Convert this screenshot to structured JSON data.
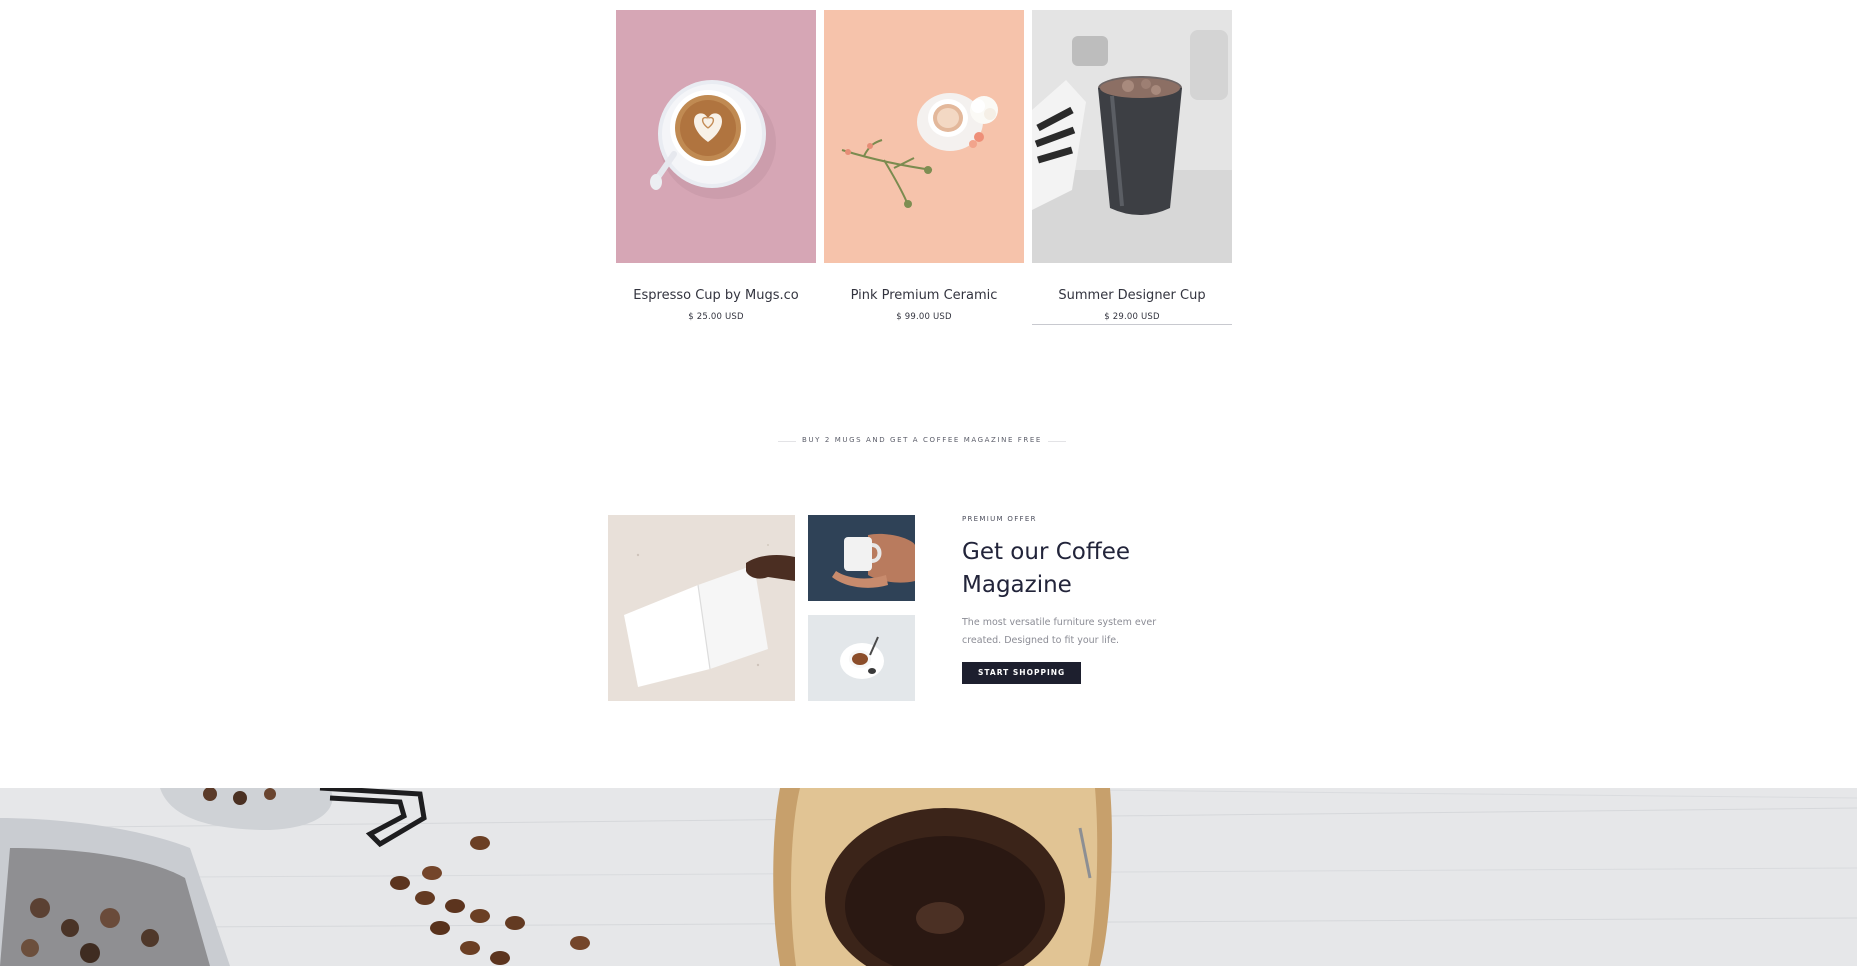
{
  "products": [
    {
      "name": "Espresso Cup by Mugs.co",
      "price": "$ 25.00 USD",
      "image": "latte-cup-on-pink-image",
      "bg": "#d6a6b5"
    },
    {
      "name": "Pink Premium Ceramic",
      "price": "$ 99.00 USD",
      "image": "ceramic-cup-with-flowers-image",
      "bg": "#f6c3ab"
    },
    {
      "name": "Summer Designer Cup",
      "price": "$ 29.00 USD",
      "image": "black-iced-coffee-cup-image",
      "bg": "#e3e3e3"
    }
  ],
  "promo": {
    "text": "BUY 2 MUGS AND GET A COFFEE MAGAZINE FREE"
  },
  "offer": {
    "eyebrow": "PREMIUM OFFER",
    "title": "Get our Coffee Magazine",
    "description": "The most versatile furniture system ever created. Designed to fit your life.",
    "button_label": "START SHOPPING"
  },
  "colors": {
    "accent_dark": "#1d1f2e",
    "text_muted": "#8b8c95",
    "pink_bg": "#d6a6b5",
    "peach_bg": "#f6c3ab"
  }
}
